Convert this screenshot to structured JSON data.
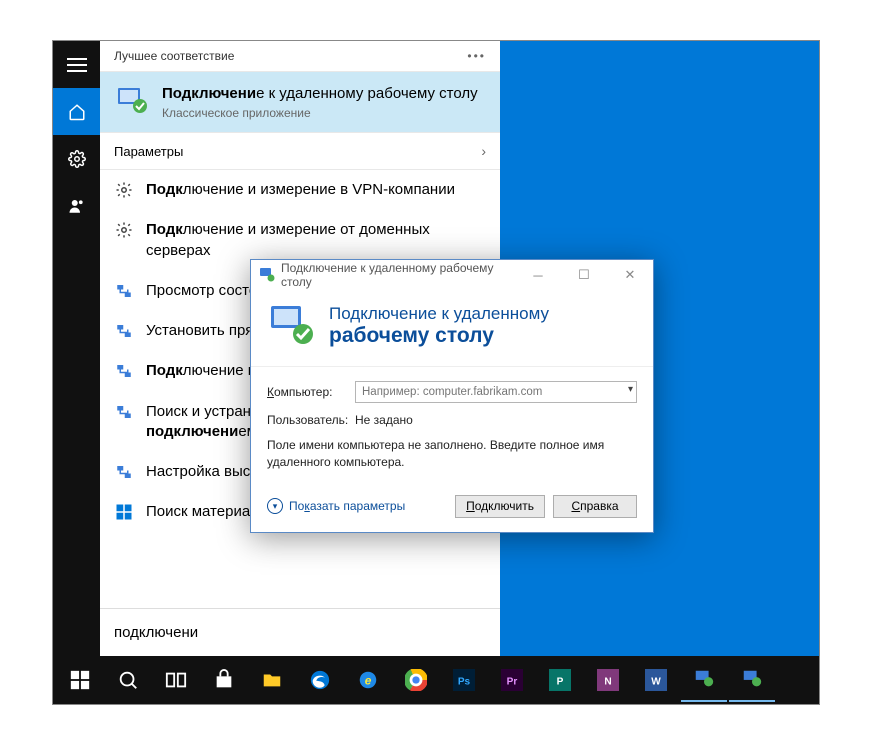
{
  "desktop": {
    "bg": "#0078d7"
  },
  "startMenu": {
    "bestMatchHeader": "Лучшее соответствие",
    "bestMatch": {
      "title_prefix": "Подключени",
      "title_rest": "е к удаленному рабочему столу",
      "subtitle": "Классическое приложение"
    },
    "paramsHeader": "Параметры",
    "results": [
      {
        "icon": "gear",
        "parts": [
          "",
          "Подк",
          "лючение и измерение в VPN-компании"
        ]
      },
      {
        "icon": "gear",
        "parts": [
          "",
          "Подк",
          "лючение и измерение от доменных серверах"
        ]
      },
      {
        "icon": "net",
        "parts": [
          "Просмотр состояния сети"
        ]
      },
      {
        "icon": "net",
        "parts": [
          "Установить прямые сет"
        ]
      },
      {
        "icon": "net",
        "parts": [
          "",
          "Подк",
          "лючение и отключение доступа столам"
        ]
      },
      {
        "icon": "net",
        "parts": [
          "Поиск и устранение проблем с сетью и ",
          "подключени",
          "ем"
        ]
      },
      {
        "icon": "net",
        "parts": [
          "Настройка высокоскоростного ",
          "подключени",
          "я"
        ]
      },
      {
        "icon": "win",
        "parts": [
          "Поиск материалов"
        ]
      }
    ],
    "searchValue": "подключени"
  },
  "rdp": {
    "titlebar": "Подключение к удаленному рабочему столу",
    "headerLine1": "Подключение к удаленному",
    "headerLine2": "рабочему столу",
    "computerLabel": "Компьютер:",
    "computerPlaceholder": "Например: computer.fabrikam.com",
    "userLabel": "Пользователь:",
    "userValue": "Не задано",
    "hint": "Поле имени компьютера не заполнено. Введите полное имя удаленного компьютера.",
    "showParams": "Показать параметры",
    "connectBtn": "Подключить",
    "helpBtn": "Справка"
  },
  "taskbar": {
    "items": [
      "start",
      "search",
      "taskview",
      "store",
      "files",
      "edge",
      "ie",
      "chrome",
      "ps",
      "pr",
      "excel",
      "onenote",
      "word",
      "rdp1",
      "rdp2"
    ]
  }
}
